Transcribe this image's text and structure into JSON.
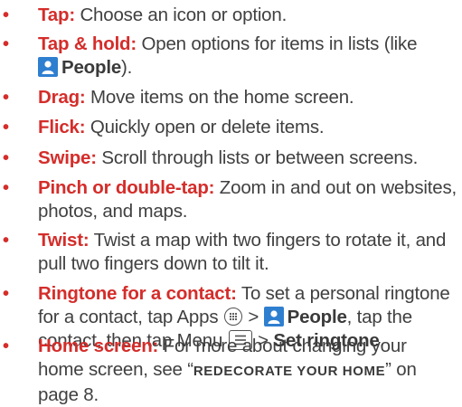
{
  "items": [
    {
      "term": "Tap:",
      "text": " Choose an icon or option."
    },
    {
      "term": "Tap & hold:",
      "text_a": " Open options for items in lists (like",
      "app": "People",
      "text_b": ")."
    },
    {
      "term": "Drag:",
      "text": " Move items on the home screen."
    },
    {
      "term": "Flick:",
      "text": " Quickly open or delete items."
    },
    {
      "term": "Swipe:",
      "text": " Scroll through lists or between screens."
    },
    {
      "term": "Pinch or double-tap:",
      "text": " Zoom in and out on websites, photos, and maps."
    },
    {
      "term": "Twist:",
      "text": " Twist a map with two fingers to rotate it, and pull two fingers down to tilt it."
    },
    {
      "term": "Ringtone for a contact:",
      "text_a": " To set a personal ringtone for a contact, tap Apps",
      "sep1": " > ",
      "app": "People",
      "text_b": ", tap the contact, then tap Menu",
      "sep2": " > ",
      "action": "Set ringtone",
      "text_c": "."
    },
    {
      "term": "Home screen:",
      "text_a": " For more about changing your home screen, see “",
      "link": "REDECORATE YOUR HOME",
      "text_b": "” on page 8."
    }
  ],
  "icons": {
    "people": "people-app-icon",
    "apps": "apps-icon",
    "menu": "menu-icon"
  },
  "colors": {
    "accent": "#d42d2a",
    "text": "#404040",
    "people_icon": "#2f7fd0"
  }
}
